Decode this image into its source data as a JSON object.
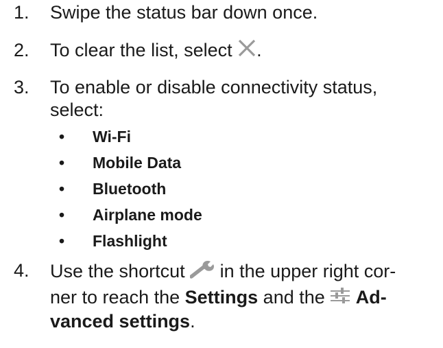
{
  "steps": [
    {
      "number": "1.",
      "text": "Swipe the status bar down once."
    },
    {
      "number": "2.",
      "text_before": "To clear the list, select",
      "icon": "close-icon",
      "text_after": "."
    },
    {
      "number": "3.",
      "line1": "To enable or disable connectivity status,",
      "line2": "select:",
      "bullet_glyph": "•",
      "options": [
        "Wi-Fi",
        "Mobile Data",
        "Bluetooth",
        "Airplane mode",
        "Flashlight"
      ]
    },
    {
      "number": "4.",
      "line1_before": "Use the shortcut",
      "icon_wrench": "wrench-icon",
      "line1_after": "in the upper right cor-",
      "line2_before": "ner to reach the",
      "settings_label": "Settings",
      "line2_mid": "and the",
      "icon_sliders": "sliders-icon",
      "advanced_part1": "Ad-",
      "advanced_part2": "vanced settings",
      "line3_after": "."
    }
  ],
  "colors": {
    "text": "#1a1a1a",
    "icon_gray": "#9a9a9a"
  }
}
